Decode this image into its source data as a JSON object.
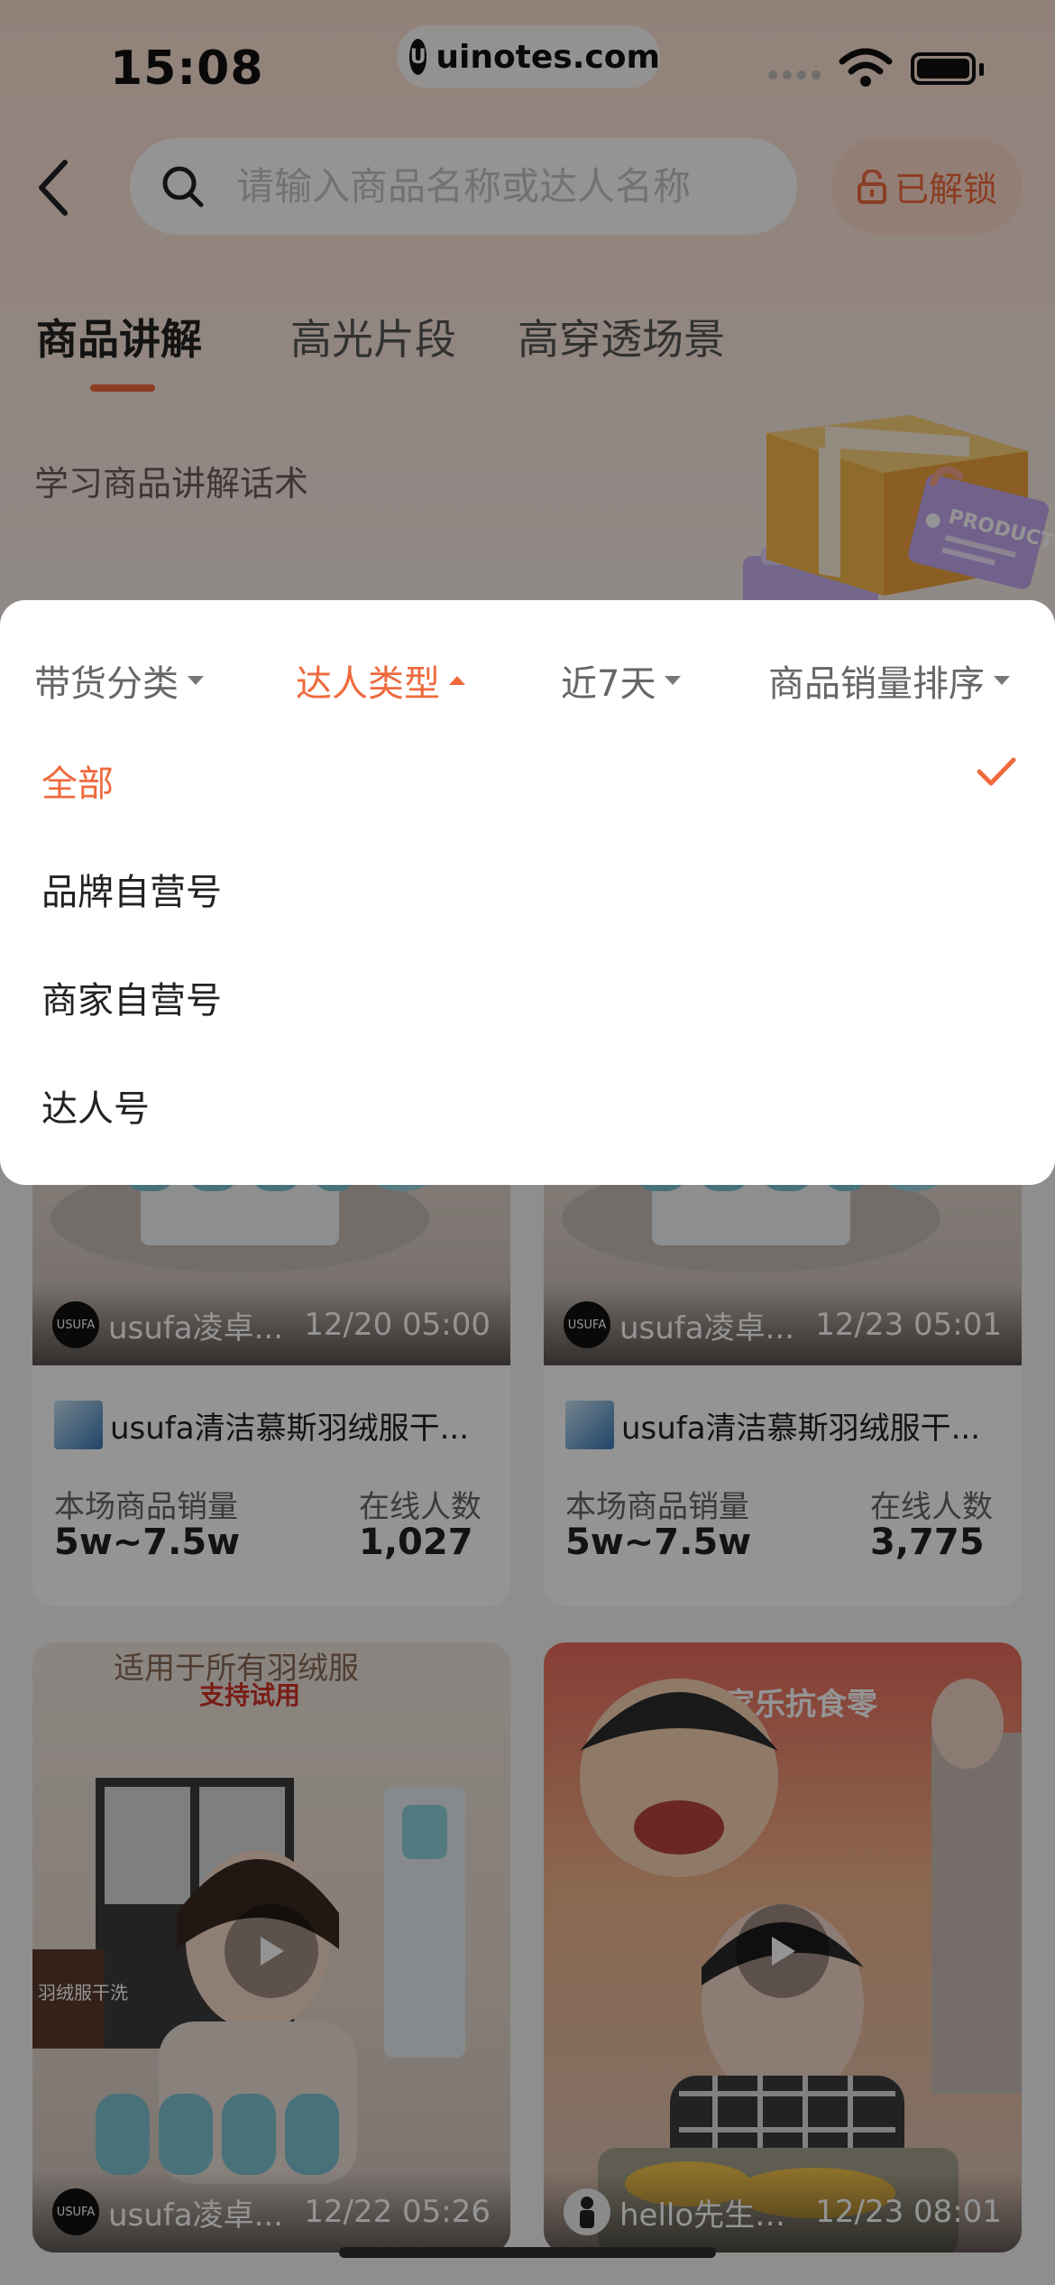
{
  "status_bar": {
    "time": "15:08",
    "url": "uinotes.com",
    "url_logo": "U"
  },
  "search": {
    "placeholder": "请输入商品名称或达人名称",
    "unlock_label": "已解锁"
  },
  "tabs": [
    {
      "label": "商品讲解",
      "active": true
    },
    {
      "label": "高光片段",
      "active": false
    },
    {
      "label": "高穿透场景",
      "active": false
    }
  ],
  "subtitle": "学习商品讲解话术",
  "illustration_text": "PRODUCT",
  "filters": [
    {
      "label": "带货分类",
      "active": false
    },
    {
      "label": "达人类型",
      "active": true
    },
    {
      "label": "近7天",
      "active": false
    },
    {
      "label": "商品销量排序",
      "active": false
    }
  ],
  "dropdown_options": [
    {
      "label": "全部",
      "selected": true
    },
    {
      "label": "品牌自营号",
      "selected": false
    },
    {
      "label": "商家自营号",
      "selected": false
    },
    {
      "label": "达人号",
      "selected": false
    }
  ],
  "cards": [
    {
      "author": "usufa凌卓...",
      "avatar_text": "USUFA",
      "time": "12/20 05:00",
      "product": "usufa清洁慕斯羽绒服干...",
      "sales_label": "本场商品销量",
      "sales_value": "5w~7.5w",
      "online_label": "在线人数",
      "online_value": "1,027"
    },
    {
      "author": "usufa凌卓...",
      "avatar_text": "USUFA",
      "time": "12/23 05:01",
      "product": "usufa清洁慕斯羽绒服干...",
      "sales_label": "本场商品销量",
      "sales_value": "5w~7.5w",
      "online_label": "在线人数",
      "online_value": "3,775"
    },
    {
      "author": "usufa凌卓...",
      "avatar_text": "USUFA",
      "time": "12/22 05:26",
      "video_caption_top": "适用于所有羽绒服",
      "video_caption_sub": "支持试用",
      "video_sign": "羽绒服干洗"
    },
    {
      "author": "hello先生☘️ ...",
      "avatar_text": "",
      "time": "12/23 08:01",
      "video_caption_top": "家乐抗食零"
    }
  ],
  "colors": {
    "accent": "#ef6a3d",
    "header_bg": "#fbe1d3",
    "unlock_bg": "#fbdac8"
  }
}
